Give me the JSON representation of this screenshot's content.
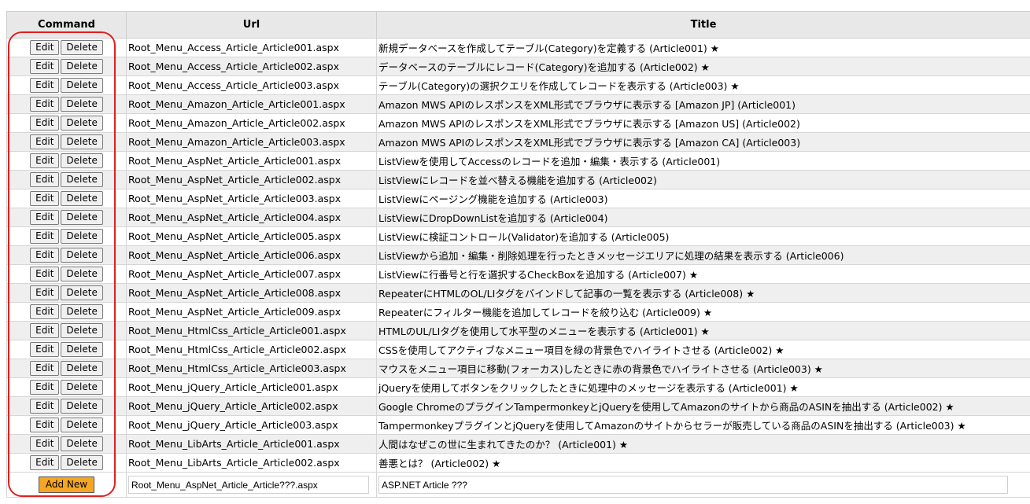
{
  "headers": {
    "command": "Command",
    "url": "Url",
    "title": "Title"
  },
  "buttons": {
    "edit": "Edit",
    "delete": "Delete",
    "add_new": "Add New"
  },
  "rows": [
    {
      "url": "Root_Menu_Access_Article_Article001.aspx",
      "title": "新規データベースを作成してテーブル(Category)を定義する (Article001) ★"
    },
    {
      "url": "Root_Menu_Access_Article_Article002.aspx",
      "title": "データベースのテーブルにレコード(Category)を追加する (Article002) ★"
    },
    {
      "url": "Root_Menu_Access_Article_Article003.aspx",
      "title": "テーブル(Category)の選択クエリを作成してレコードを表示する (Article003) ★"
    },
    {
      "url": "Root_Menu_Amazon_Article_Article001.aspx",
      "title": "Amazon MWS APIのレスポンスをXML形式でブラウザに表示する [Amazon JP] (Article001)"
    },
    {
      "url": "Root_Menu_Amazon_Article_Article002.aspx",
      "title": "Amazon MWS APIのレスポンスをXML形式でブラウザに表示する [Amazon US] (Article002)"
    },
    {
      "url": "Root_Menu_Amazon_Article_Article003.aspx",
      "title": "Amazon MWS APIのレスポンスをXML形式でブラウザに表示する [Amazon CA] (Article003)"
    },
    {
      "url": "Root_Menu_AspNet_Article_Article001.aspx",
      "title": "ListViewを使用してAccessのレコードを追加・編集・表示する (Article001)"
    },
    {
      "url": "Root_Menu_AspNet_Article_Article002.aspx",
      "title": "ListViewにレコードを並べ替える機能を追加する (Article002)"
    },
    {
      "url": "Root_Menu_AspNet_Article_Article003.aspx",
      "title": "ListViewにページング機能を追加する (Article003)"
    },
    {
      "url": "Root_Menu_AspNet_Article_Article004.aspx",
      "title": "ListViewにDropDownListを追加する (Article004)"
    },
    {
      "url": "Root_Menu_AspNet_Article_Article005.aspx",
      "title": "ListViewに検証コントロール(Validator)を追加する (Article005)"
    },
    {
      "url": "Root_Menu_AspNet_Article_Article006.aspx",
      "title": "ListViewから追加・編集・削除処理を行ったときメッセージエリアに処理の結果を表示する (Article006)"
    },
    {
      "url": "Root_Menu_AspNet_Article_Article007.aspx",
      "title": "ListViewに行番号と行を選択するCheckBoxを追加する (Article007) ★"
    },
    {
      "url": "Root_Menu_AspNet_Article_Article008.aspx",
      "title": "RepeaterにHTMLのOL/LIタグをバインドして記事の一覧を表示する (Article008) ★"
    },
    {
      "url": "Root_Menu_AspNet_Article_Article009.aspx",
      "title": "Repeaterにフィルター機能を追加してレコードを絞り込む (Article009) ★"
    },
    {
      "url": "Root_Menu_HtmlCss_Article_Article001.aspx",
      "title": "HTMLのUL/LIタグを使用して水平型のメニューを表示する (Article001) ★"
    },
    {
      "url": "Root_Menu_HtmlCss_Article_Article002.aspx",
      "title": "CSSを使用してアクティブなメニュー項目を緑の背景色でハイライトさせる (Article002) ★"
    },
    {
      "url": "Root_Menu_HtmlCss_Article_Article003.aspx",
      "title": "マウスをメニュー項目に移動(フォーカス)したときに赤の背景色でハイライトさせる (Article003) ★"
    },
    {
      "url": "Root_Menu_jQuery_Article_Article001.aspx",
      "title": "jQueryを使用してボタンをクリックしたときに処理中のメッセージを表示する (Article001) ★"
    },
    {
      "url": "Root_Menu_jQuery_Article_Article002.aspx",
      "title": "Google ChromeのプラグインTampermonkeyとjQueryを使用してAmazonのサイトから商品のASINを抽出する (Article002) ★"
    },
    {
      "url": "Root_Menu_jQuery_Article_Article003.aspx",
      "title": "TampermonkeyプラグインとjQueryを使用してAmazonのサイトからセラーが販売している商品のASINを抽出する (Article003) ★"
    },
    {
      "url": "Root_Menu_LibArts_Article_Article001.aspx",
      "title": "人間はなぜこの世に生まれてきたのか？ (Article001) ★"
    },
    {
      "url": "Root_Menu_LibArts_Article_Article002.aspx",
      "title": "善悪とは？ (Article002) ★"
    }
  ],
  "new_row": {
    "url_value": "Root_Menu_AspNet_Article_Article???.aspx",
    "title_value": "ASP.NET Article ???"
  },
  "colors": {
    "header_bg": "#e8e8e8",
    "alt_row_bg": "#efefef",
    "add_button": "#f5a623",
    "highlight": "#e0201e"
  }
}
